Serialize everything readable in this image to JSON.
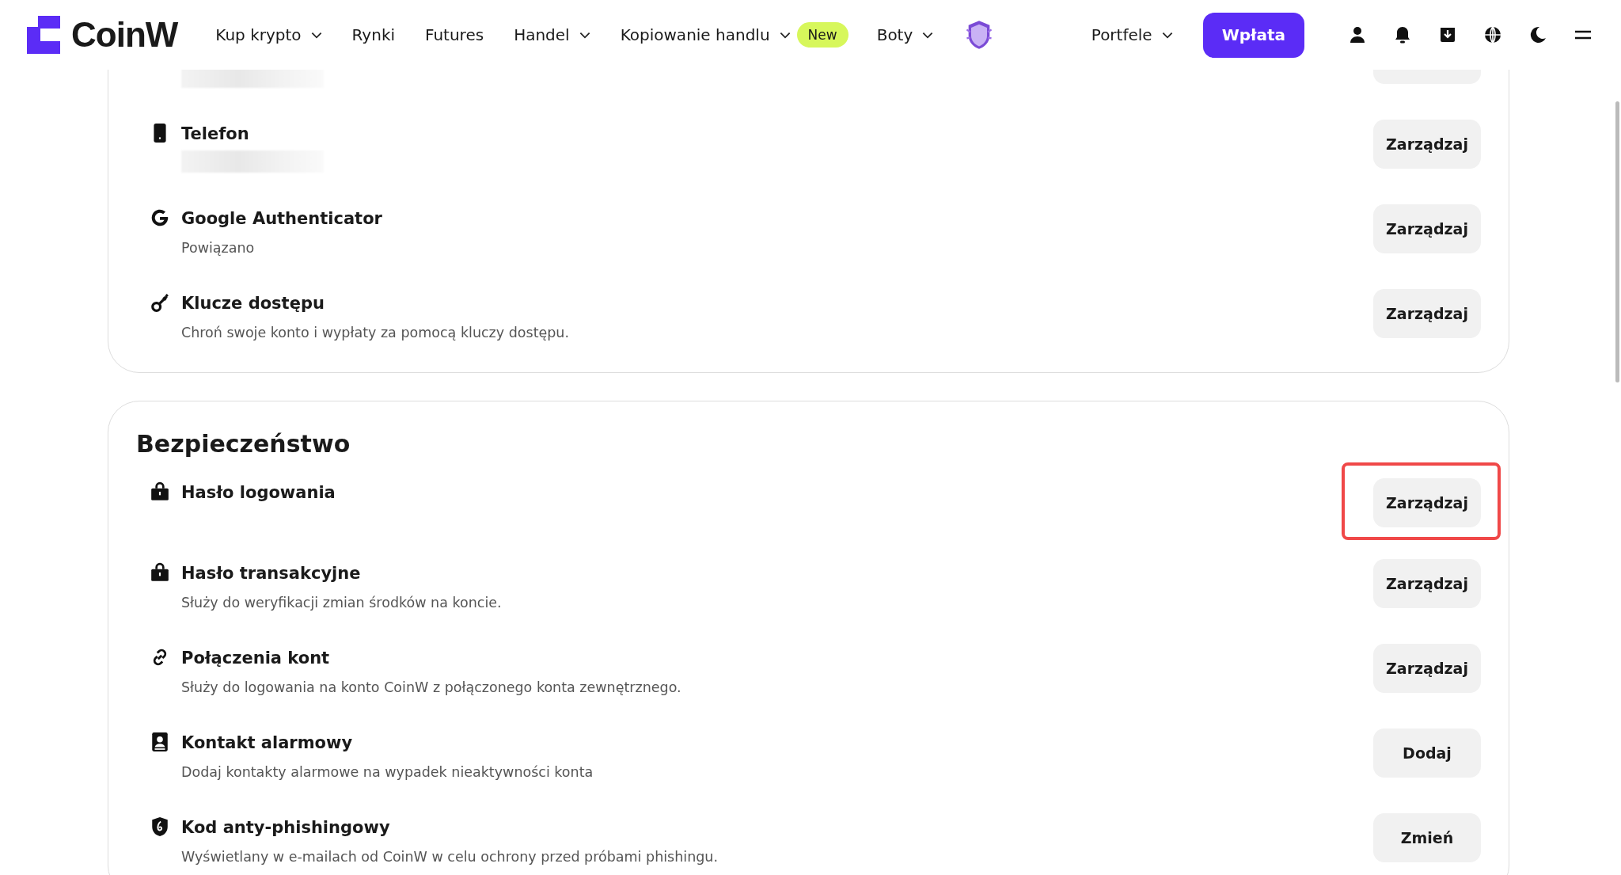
{
  "header": {
    "logo": "CoinW",
    "nav": [
      {
        "label": "Kup krypto",
        "dropdown": true
      },
      {
        "label": "Rynki",
        "dropdown": false
      },
      {
        "label": "Futures",
        "dropdown": false
      },
      {
        "label": "Handel",
        "dropdown": true
      },
      {
        "label": "Kopiowanie handlu",
        "dropdown": true,
        "badge": "New"
      },
      {
        "label": "Boty",
        "dropdown": true
      }
    ],
    "wallet": {
      "label": "Portfele",
      "dropdown": true
    },
    "deposit_button": "Wpłata"
  },
  "cards": [
    {
      "items": [
        {
          "kind": "masked",
          "highlighted": false
        },
        {
          "kind": "phone",
          "title": "Telefon",
          "masked_value": true,
          "button": "Zarządzaj",
          "highlighted": false
        },
        {
          "kind": "google",
          "title": "Google Authenticator",
          "description": "Powiązano",
          "button": "Zarządzaj",
          "highlighted": false
        },
        {
          "kind": "key",
          "title": "Klucze dostępu",
          "description": "Chroń swoje konto i wypłaty za pomocą kluczy dostępu.",
          "button": "Zarządzaj",
          "highlighted": false
        }
      ]
    },
    {
      "title": "Bezpieczeństwo",
      "items": [
        {
          "kind": "lock",
          "title": "Hasło logowania",
          "button": "Zarządzaj",
          "highlighted": true
        },
        {
          "kind": "lock",
          "title": "Hasło transakcyjne",
          "description": "Służy do weryfikacji zmian środków na koncie.",
          "button": "Zarządzaj",
          "highlighted": false
        },
        {
          "kind": "link",
          "title": "Połączenia kont",
          "description": "Służy do logowania na konto CoinW z połączonego konta zewnętrznego.",
          "button": "Zarządzaj",
          "highlighted": false
        },
        {
          "kind": "contact",
          "title": "Kontakt alarmowy",
          "description": "Dodaj kontakty alarmowe na wypadek nieaktywności konta",
          "button": "Dodaj",
          "highlighted": false
        },
        {
          "kind": "shield",
          "title": "Kod anty-phishingowy",
          "description": "Wyświetlany w e-mailach od CoinW w celu ochrony przed próbami phishingu.",
          "button": "Zmień",
          "highlighted": false
        }
      ]
    }
  ]
}
